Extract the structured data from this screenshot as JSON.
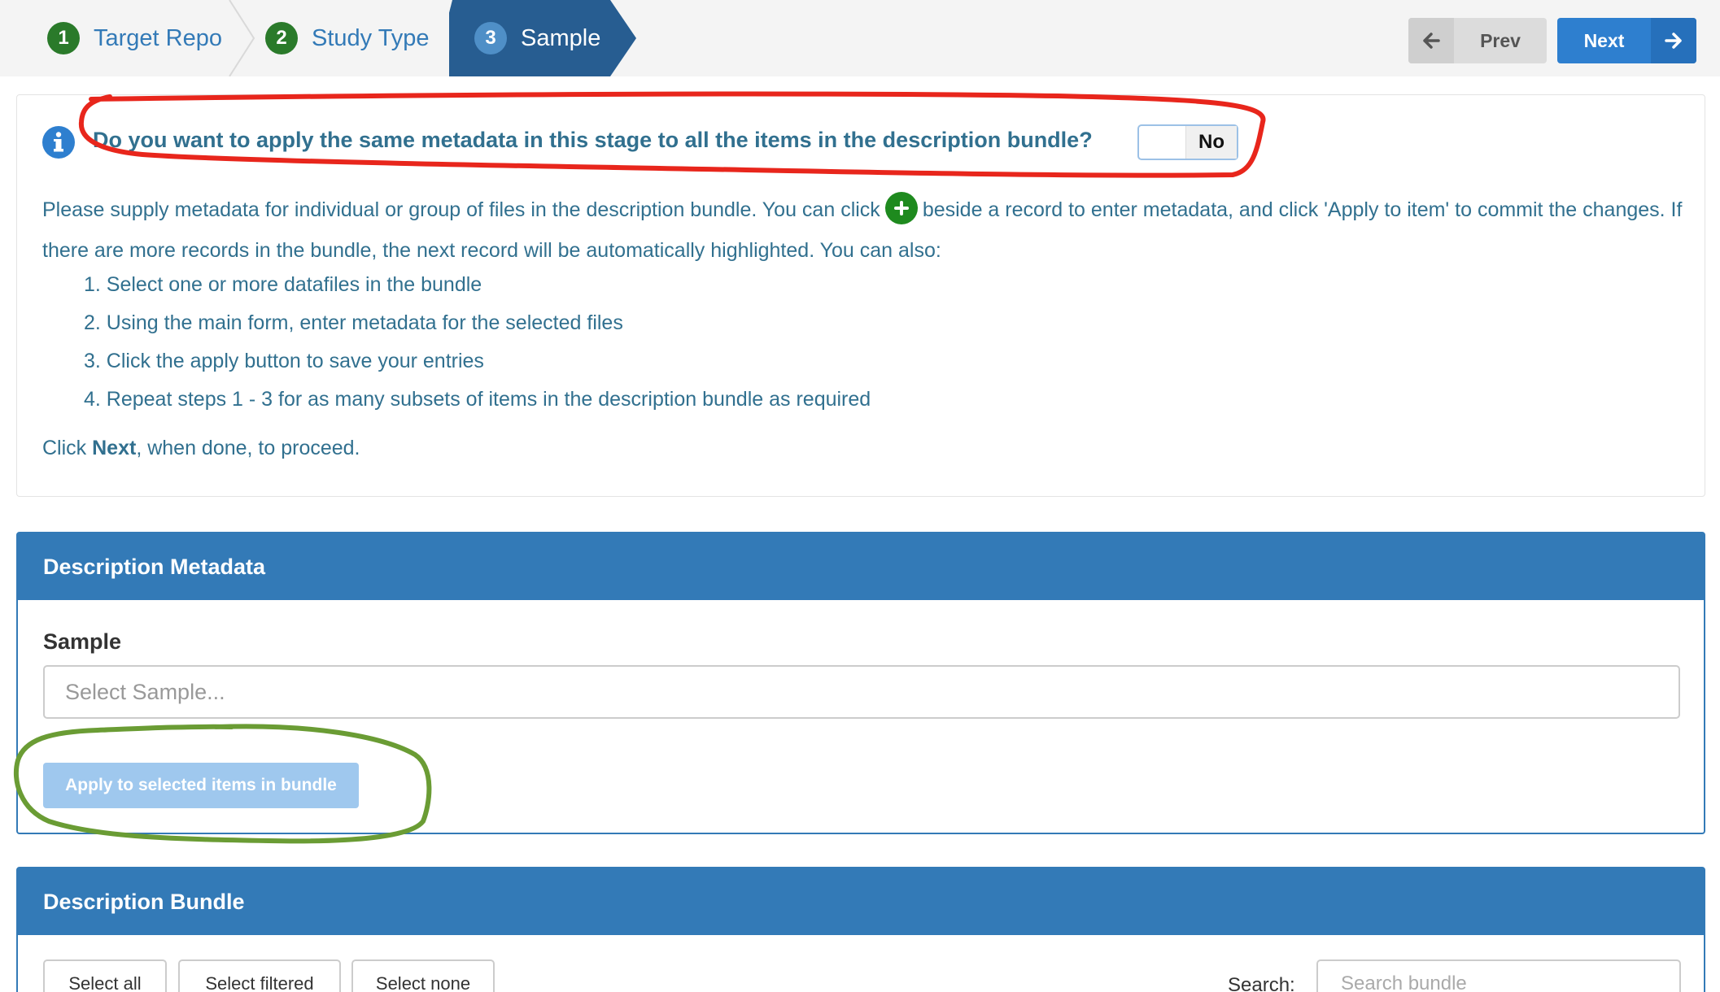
{
  "wizard": {
    "steps": [
      {
        "number": "1",
        "label": "Target Repo"
      },
      {
        "number": "2",
        "label": "Study Type"
      },
      {
        "number": "3",
        "label": "Sample"
      }
    ],
    "prev_label": "Prev",
    "next_label": "Next"
  },
  "info": {
    "question": "Do you want to apply the same metadata in this stage to all the items in the description bundle?",
    "toggle_value": "No",
    "intro_before_icon": "Please supply metadata for individual or group of files in the description bundle. You can click",
    "intro_after_icon": "beside a record to enter metadata, and click 'Apply to item' to commit the changes. If there are more records in the bundle, the next record will be automatically highlighted. You can also:",
    "steps": [
      "1. Select one or more datafiles in the bundle",
      "2. Using the main form, enter metadata for the selected files",
      "3. Click the apply button to save your entries",
      "4. Repeat steps 1 - 3 for as many subsets of items in the description bundle as required"
    ],
    "proceed_prefix": "Click",
    "proceed_bold": "Next",
    "proceed_suffix": ", when done, to proceed."
  },
  "metadata_panel": {
    "title": "Description Metadata",
    "field_label": "Sample",
    "placeholder": "Select Sample...",
    "apply_label": "Apply to selected items in bundle"
  },
  "bundle_panel": {
    "title": "Description Bundle",
    "select_all": "Select all",
    "select_filtered": "Select filtered",
    "select_none": "Select none",
    "search_label": "Search:",
    "search_placeholder": "Search bundle"
  },
  "colors": {
    "primary": "#337ab7",
    "info_text": "#31708f",
    "step_done": "#2a7a2a",
    "annotation_red": "#e8261c",
    "annotation_green": "#6a9c34"
  }
}
